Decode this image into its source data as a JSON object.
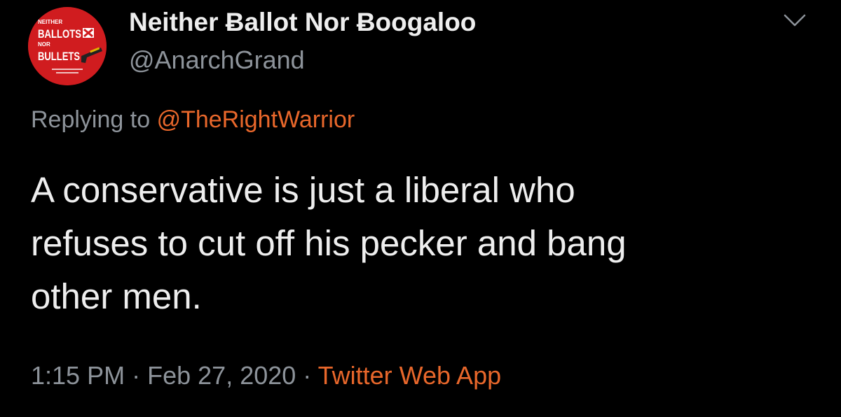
{
  "author": {
    "display_name": "Neither Ƀallot Nor Ƀoogaloo",
    "handle": "@AnarchGrand",
    "avatar": {
      "icon": "ballots-bullets-logo-icon",
      "text_lines": [
        "NEITHER",
        "BALLOTS",
        "NOR",
        "BULLETS"
      ],
      "background": "#d01c1f"
    }
  },
  "menu": {
    "icon": "chevron-down-icon"
  },
  "reply": {
    "prefix": "Replying to",
    "target": "@TheRightWarrior"
  },
  "tweet": {
    "lines": [
      "A conservative is just a liberal who",
      "refuses to cut off his pecker and bang",
      "other men."
    ]
  },
  "meta": {
    "time": "1:15 PM",
    "separator": "·",
    "date": "Feb 27, 2020",
    "source": "Twitter Web App"
  },
  "colors": {
    "background": "#000000",
    "accent": "#e8672b",
    "muted": "#8d939a",
    "text": "#eeeeee"
  }
}
